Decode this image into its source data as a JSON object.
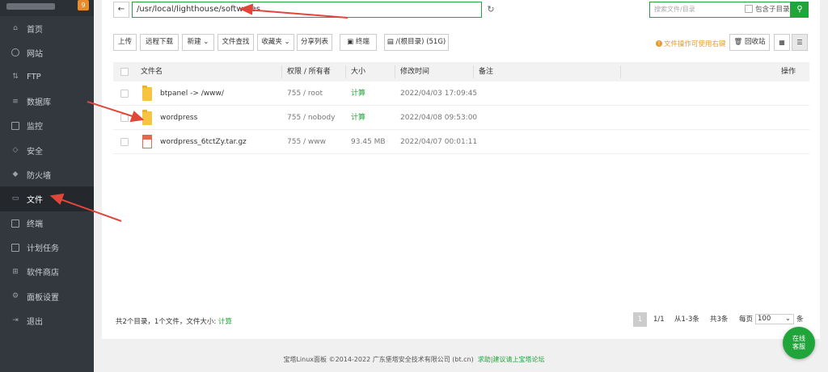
{
  "sidebar": {
    "badge": "9",
    "items": [
      {
        "label": "首页",
        "icon": "home-icon"
      },
      {
        "label": "网站",
        "icon": "globe-icon"
      },
      {
        "label": "FTP",
        "icon": "ftp-icon"
      },
      {
        "label": "数据库",
        "icon": "database-icon"
      },
      {
        "label": "监控",
        "icon": "monitor-icon"
      },
      {
        "label": "安全",
        "icon": "shield-icon"
      },
      {
        "label": "防火墙",
        "icon": "firewall-icon"
      },
      {
        "label": "文件",
        "icon": "folder-icon"
      },
      {
        "label": "终端",
        "icon": "terminal-icon"
      },
      {
        "label": "计划任务",
        "icon": "task-icon"
      },
      {
        "label": "软件商店",
        "icon": "store-icon"
      },
      {
        "label": "面板设置",
        "icon": "settings-icon"
      },
      {
        "label": "退出",
        "icon": "logout-icon"
      }
    ]
  },
  "pathbar": {
    "path": "/usr/local/lighthouse/softwares",
    "search_placeholder": "搜索文件/目录",
    "include_subdir": "包含子目录"
  },
  "toolbar": {
    "upload": "上传",
    "remote_download": "远程下载",
    "new": "新建",
    "file_search": "文件查找",
    "favorites": "收藏夹",
    "share_list": "分享列表",
    "terminal": "终端",
    "disk": "/(根目录) (51G)",
    "tip": "文件操作可使用右键",
    "recycle": "回收站"
  },
  "table": {
    "headers": {
      "name": "文件名",
      "perm": "权限 / 所有者",
      "size": "大小",
      "mtime": "修改时间",
      "note": "备注",
      "ops": "操作"
    },
    "rows": [
      {
        "name": "btpanel -> /www/",
        "perm": "755 / root",
        "size": "计算",
        "mtime": "2022/04/03 17:09:45",
        "type": "folder"
      },
      {
        "name": "wordpress",
        "perm": "755 / nobody",
        "size": "计算",
        "mtime": "2022/04/08 09:53:00",
        "type": "folder"
      },
      {
        "name": "wordpress_6tctZy.tar.gz",
        "perm": "755 / www",
        "size": "93.45 MB",
        "mtime": "2022/04/07 00:01:11",
        "type": "archive"
      }
    ]
  },
  "footer": {
    "summary": "共2个目录，1个文件，文件大小:",
    "summary_link": "计算",
    "page_current": "1",
    "page_total": "1/1",
    "range": "从1-3条",
    "count": "共3条",
    "per_page_label": "每页",
    "per_page_value": "100",
    "per_page_unit": "条"
  },
  "copyright": {
    "text": "宝塔Linux面板 ©2014-2022 广东堡塔安全技术有限公司 (bt.cn)",
    "link": "求助|建议请上宝塔论坛"
  },
  "online_service": {
    "line1": "在线",
    "line2": "客服"
  },
  "colors": {
    "accent": "#20a53a",
    "sidebar": "#33383f",
    "annotation": "#e0463a"
  }
}
